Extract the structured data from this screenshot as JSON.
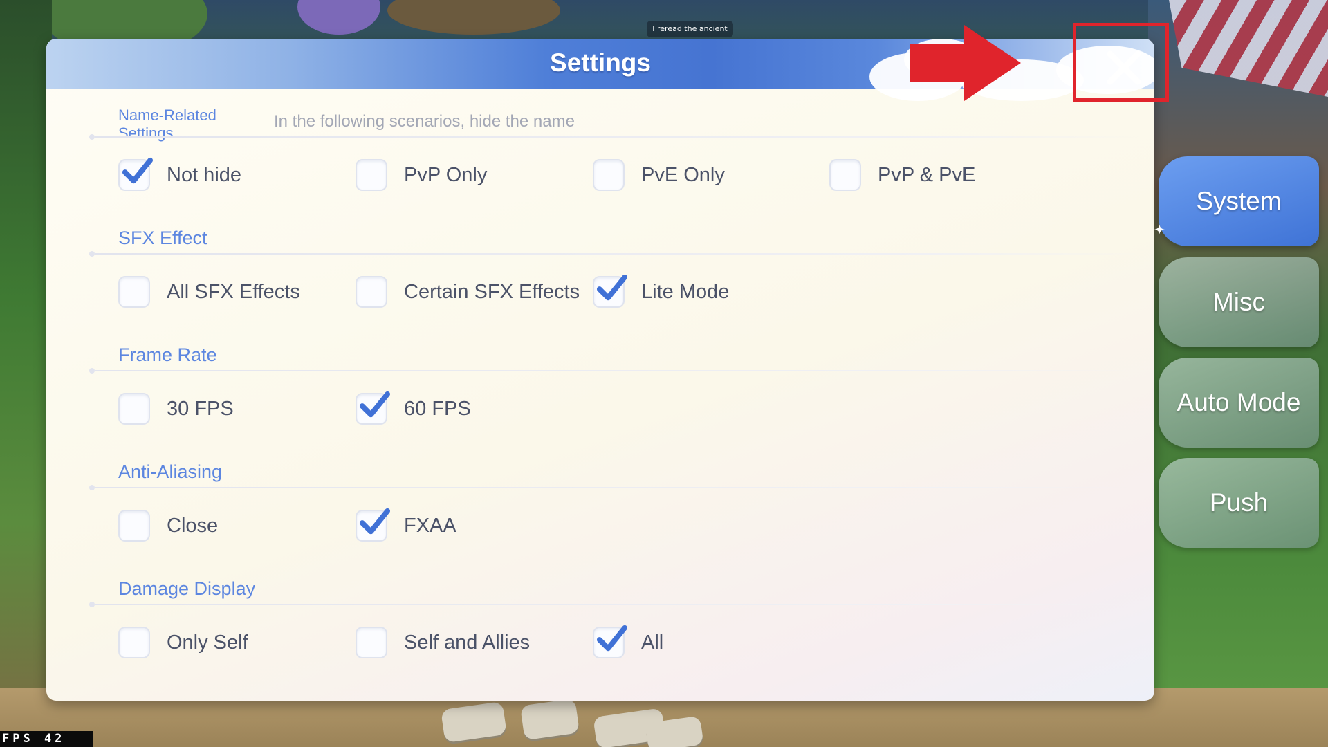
{
  "panel": {
    "title": "Settings",
    "sections": [
      {
        "label": "Name-Related Settings",
        "hint": "In the following scenarios, hide the name",
        "options": [
          {
            "label": "Not hide",
            "checked": true
          },
          {
            "label": "PvP Only",
            "checked": false
          },
          {
            "label": "PvE Only",
            "checked": false
          },
          {
            "label": "PvP & PvE",
            "checked": false
          }
        ]
      },
      {
        "label": "SFX Effect",
        "options": [
          {
            "label": "All SFX Effects",
            "checked": false
          },
          {
            "label": "Certain SFX Effects",
            "checked": false
          },
          {
            "label": "Lite Mode",
            "checked": true
          }
        ]
      },
      {
        "label": "Frame Rate",
        "options": [
          {
            "label": "30 FPS",
            "checked": false
          },
          {
            "label": "60 FPS",
            "checked": true
          }
        ]
      },
      {
        "label": "Anti-Aliasing",
        "options": [
          {
            "label": "Close",
            "checked": false
          },
          {
            "label": "FXAA",
            "checked": true
          }
        ]
      },
      {
        "label": "Damage Display",
        "options": [
          {
            "label": "Only Self",
            "checked": false
          },
          {
            "label": "Self and Allies",
            "checked": false
          },
          {
            "label": "All",
            "checked": true
          }
        ]
      }
    ]
  },
  "tabs": [
    {
      "label": "System",
      "active": true
    },
    {
      "label": "Misc",
      "active": false
    },
    {
      "label": "Auto Mode",
      "active": false
    },
    {
      "label": "Push",
      "active": false
    }
  ],
  "speech_bubble": "I reread the ancient",
  "fps_counter": "FPS  42",
  "icons": {
    "close": "close-icon",
    "check": "checkmark-icon",
    "annotation": "red-arrow-icon"
  },
  "colors": {
    "accent": "#4a7bd8",
    "section": "#5c86e0",
    "annotation": "#e0242c"
  }
}
